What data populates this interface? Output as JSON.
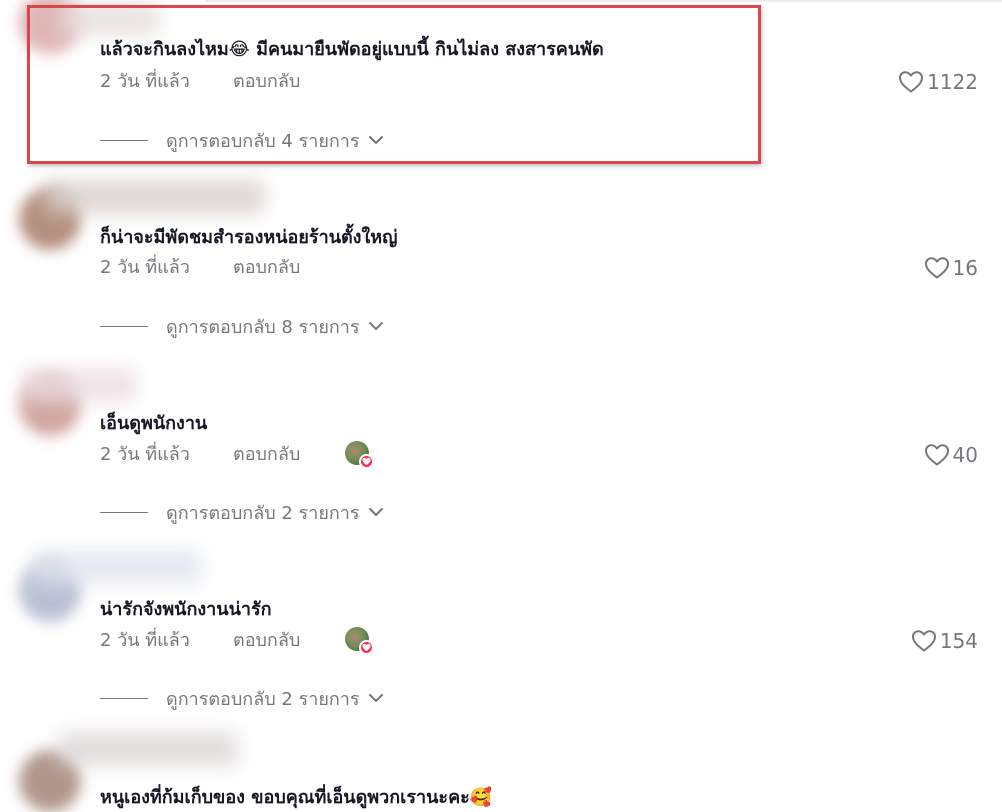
{
  "comments": [
    {
      "text": "แล้วจะกินลงไหม",
      "emoji": "😂",
      "text_after": " มีคนมายืนพัดอยู่แบบนี้ กินไม่ลง สงสารคนพัด",
      "time": "2 วัน ที่แล้ว",
      "reply": "ตอบกลับ",
      "likes": "1122",
      "view_replies": "ดูการตอบกลับ 4 รายการ",
      "creator_liked": false
    },
    {
      "text": "ก็น่าจะมีพัดชมสำรองหน่อยร้านตั้งใหญ่",
      "emoji": "",
      "text_after": "",
      "time": "2 วัน ที่แล้ว",
      "reply": "ตอบกลับ",
      "likes": "16",
      "view_replies": "ดูการตอบกลับ 8 รายการ",
      "creator_liked": false
    },
    {
      "text": "เอ็นดูพนักงาน",
      "emoji": "",
      "text_after": "",
      "time": "2 วัน ที่แล้ว",
      "reply": "ตอบกลับ",
      "likes": "40",
      "view_replies": "ดูการตอบกลับ 2 รายการ",
      "creator_liked": true
    },
    {
      "text": "น่ารักจังพนักงานน่ารัก",
      "emoji": "",
      "text_after": "",
      "time": "2 วัน ที่แล้ว",
      "reply": "ตอบกลับ",
      "likes": "154",
      "view_replies": "ดูการตอบกลับ 2 รายการ",
      "creator_liked": true
    },
    {
      "text": "หนูเองที่ก้มเก็บของ ขอบคุณที่เอ็นดูพวกเรานะคะ",
      "emoji": "🥰",
      "text_after": "",
      "time": "",
      "reply": "",
      "likes": "",
      "view_replies": "",
      "creator_liked": false
    }
  ],
  "colors": {
    "text": "#161823",
    "secondary": "#75777c",
    "highlight_border": "#d9474c",
    "creator_heart": "#fe2c55"
  },
  "icons": {
    "like": "heart-outline-icon",
    "expand": "chevron-down-icon",
    "creator_like": "creator-liked-badge-icon"
  }
}
